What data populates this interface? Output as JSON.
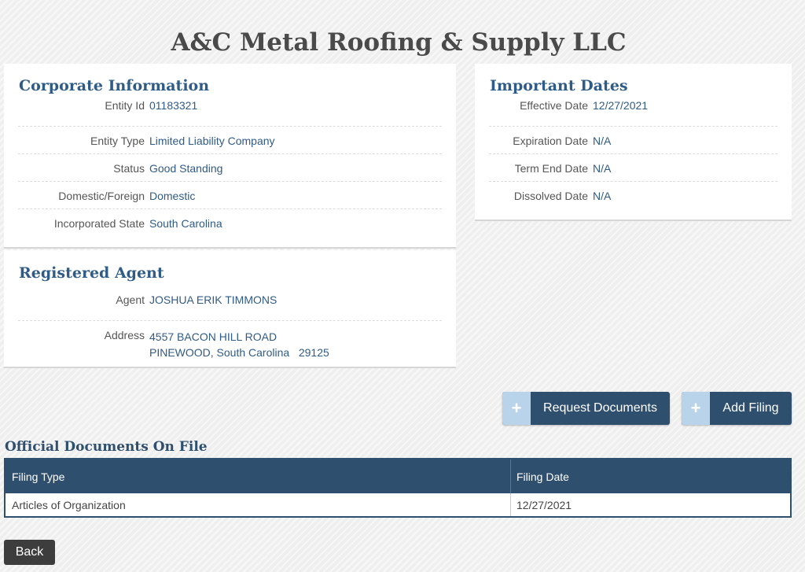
{
  "entity": {
    "name": "A&C Metal Roofing & Supply LLC"
  },
  "corporate": {
    "title": "Corporate Information",
    "rows": [
      {
        "label": "Entity Id",
        "value": "01183321"
      },
      {
        "label": "Entity Type",
        "value": "Limited Liability Company"
      },
      {
        "label": "Status",
        "value": "Good Standing"
      },
      {
        "label": "Domestic/Foreign",
        "value": "Domestic"
      },
      {
        "label": "Incorporated State",
        "value": "South Carolina"
      }
    ]
  },
  "dates": {
    "title": "Important Dates",
    "rows": [
      {
        "label": "Effective Date",
        "value": "12/27/2021"
      },
      {
        "label": "Expiration Date",
        "value": "N/A"
      },
      {
        "label": "Term End Date",
        "value": "N/A"
      },
      {
        "label": "Dissolved Date",
        "value": "N/A"
      }
    ]
  },
  "agent": {
    "title": "Registered Agent",
    "agent_label": "Agent",
    "agent_name": "JOSHUA ERIK TIMMONS",
    "address_label": "Address",
    "address_line1": "4557 BACON HILL ROAD",
    "address_line2": "PINEWOOD, South Carolina   29125"
  },
  "actions": {
    "request_documents": "Request Documents",
    "add_filing": "Add Filing",
    "plus_glyph": "+"
  },
  "documents": {
    "title": "Official Documents On File",
    "headers": {
      "filing_type": "Filing Type",
      "filing_date": "Filing Date"
    },
    "rows": [
      {
        "filing_type": "Articles of Organization",
        "filing_date": "12/27/2021"
      }
    ]
  },
  "back_label": "Back"
}
